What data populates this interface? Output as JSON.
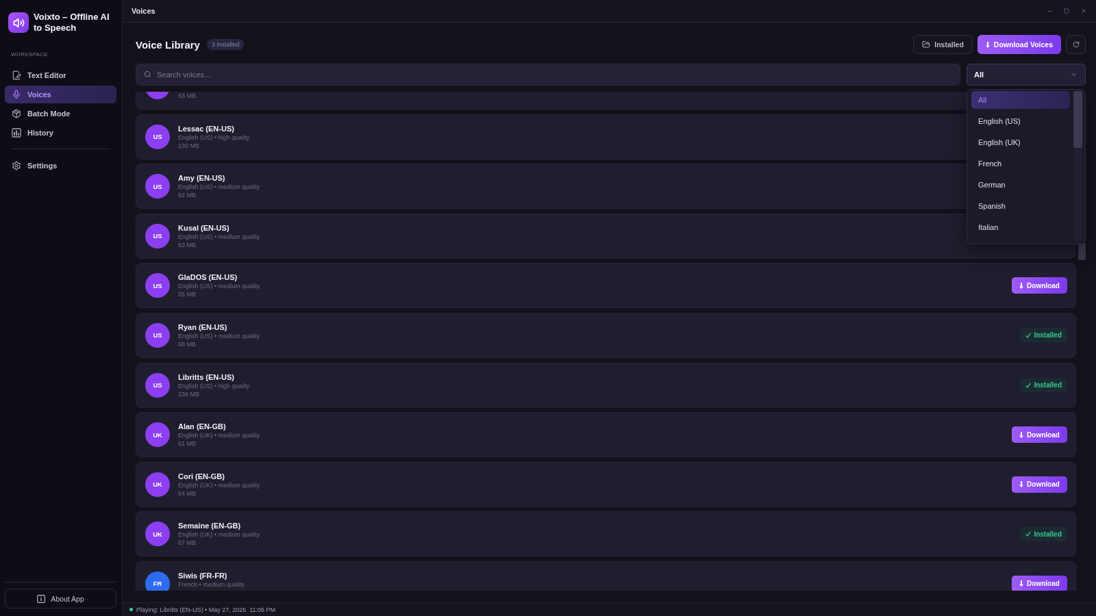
{
  "window": {
    "title": "Voices"
  },
  "app": {
    "name": "Voixto – Offline AI to Speech"
  },
  "sidebar": {
    "section_label": "WORKSPACE",
    "items": [
      {
        "label": "Text Editor",
        "selected": false
      },
      {
        "label": "Voices",
        "selected": true
      },
      {
        "label": "Batch Mode",
        "selected": false
      },
      {
        "label": "History",
        "selected": false
      }
    ],
    "secondary_items": [
      {
        "label": "Settings",
        "selected": false
      }
    ],
    "footer_button": "About App"
  },
  "header": {
    "title": "Voice Library",
    "badge": "3 installed",
    "buttons": [
      {
        "label": "Installed",
        "kind": "outline"
      },
      {
        "label": "Download Voices",
        "kind": "primary"
      }
    ]
  },
  "search": {
    "placeholder": "Search voices..."
  },
  "filter": {
    "value": "All",
    "expanded": true,
    "options": [
      {
        "label": "All",
        "selected": true
      },
      {
        "label": "English (US)",
        "selected": false
      },
      {
        "label": "English (UK)",
        "selected": false
      },
      {
        "label": "French",
        "selected": false
      },
      {
        "label": "German",
        "selected": false
      },
      {
        "label": "Spanish",
        "selected": false
      },
      {
        "label": "Italian",
        "selected": false
      }
    ]
  },
  "voices": [
    {
      "color": "#8b3ff0",
      "size": "63 MB"
    },
    {
      "initials": "US",
      "color": "#8b3ff0",
      "name": "Lessac (EN-US)",
      "details": "English (US) • high quality",
      "size": "130 MB"
    },
    {
      "initials": "US",
      "color": "#8b3ff0",
      "name": "Amy (EN-US)",
      "details": "English (US) • medium quality",
      "size": "62 MB"
    },
    {
      "initials": "US",
      "color": "#8b3ff0",
      "name": "Kusal (EN-US)",
      "details": "English (US) • medium quality",
      "size": "63 MB"
    },
    {
      "initials": "US",
      "color": "#8b3ff0",
      "name": "GlaDOS (EN-US)",
      "details": "English (US) • medium quality",
      "size": "55 MB",
      "action": {
        "kind": "download",
        "label": "Download"
      }
    },
    {
      "initials": "US",
      "color": "#8b3ff0",
      "name": "Ryan (EN-US)",
      "details": "English (US) • medium quality",
      "size": "68 MB",
      "action": {
        "kind": "installed",
        "label": "Installed"
      }
    },
    {
      "initials": "US",
      "color": "#8b3ff0",
      "name": "Libritts (EN-US)",
      "details": "English (US) • high quality",
      "size": "236 MB",
      "action": {
        "kind": "installed",
        "label": "Installed"
      }
    },
    {
      "initials": "UK",
      "color": "#8b3ff0",
      "name": "Alan (EN-GB)",
      "details": "English (UK) • medium quality",
      "size": "61 MB",
      "action": {
        "kind": "download",
        "label": "Download"
      }
    },
    {
      "initials": "UK",
      "color": "#8b3ff0",
      "name": "Cori (EN-GB)",
      "details": "English (UK) • medium quality",
      "size": "64 MB",
      "action": {
        "kind": "download",
        "label": "Download"
      }
    },
    {
      "initials": "UK",
      "color": "#8b3ff0",
      "name": "Semaine (EN-GB)",
      "details": "English (UK) • medium quality",
      "size": "67 MB",
      "action": {
        "kind": "installed",
        "label": "Installed"
      }
    },
    {
      "initials": "FR",
      "color": "#2f6bef",
      "name": "Siwis (FR-FR)",
      "details": "French • medium quality",
      "action": {
        "kind": "download",
        "label": "Download"
      }
    }
  ],
  "status_bar": {
    "text": "Playing: Libritts (EN-US) • May 27, 2026  11:06 PM"
  }
}
